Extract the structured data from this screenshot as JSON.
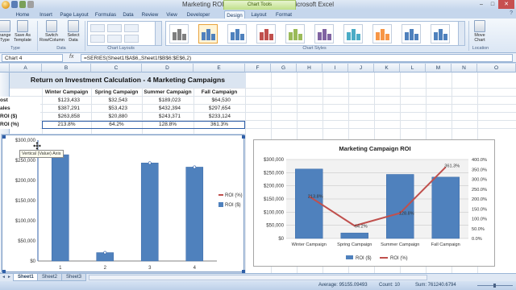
{
  "window": {
    "title": "Marketing ROI Calculation Example - Microsoft Excel",
    "context_tab": "Chart Tools"
  },
  "ribbon_tabs": [
    "Home",
    "Insert",
    "Page Layout",
    "Formulas",
    "Data",
    "Review",
    "View",
    "Developer",
    "Design",
    "Layout",
    "Format"
  ],
  "active_tab": "Design",
  "ribbon": {
    "change_type": "hange\nType",
    "save_template": "Save As\nTemplate",
    "switch": "Switch\nRow/Column",
    "select_data": "Select\nData",
    "move_chart": "Move\nChart",
    "groups": {
      "type": "Type",
      "data": "Data",
      "layouts": "Chart Layouts",
      "styles": "Chart Styles",
      "location": "Location"
    },
    "style_colors": [
      "#7f7f7f",
      "#4f81bd",
      "#4f81bd",
      "#c0504d",
      "#9bbb59",
      "#8064a2",
      "#4bacc6",
      "#f79646",
      "#4f81bd",
      "#4f81bd"
    ]
  },
  "formula_bar": {
    "name_box": "Chart 4",
    "fx": "fx",
    "formula": "=SERIES(Sheet1!$A$6,,Sheet1!$B$6:$E$6,2)"
  },
  "columns": [
    "A",
    "B",
    "C",
    "D",
    "E",
    "F",
    "G",
    "H",
    "I",
    "J",
    "K",
    "L",
    "M",
    "N",
    "O"
  ],
  "table": {
    "title": "Return on Investment Calculation - 4 Marketing Campaigns",
    "headers": [
      "Winter Campaign",
      "Spring Campaign",
      "Summer Campaign",
      "Fall Campaign"
    ],
    "rows": [
      {
        "label": "ost",
        "values": [
          "$123,433",
          "$32,543",
          "$189,023",
          "$64,530"
        ]
      },
      {
        "label": "ales",
        "values": [
          "$387,291",
          "$53,423",
          "$432,394",
          "$297,654"
        ]
      },
      {
        "label": "ROI ($)",
        "values": [
          "$263,858",
          "$20,880",
          "$243,371",
          "$233,124"
        ]
      },
      {
        "label": "ROI (%)",
        "values": [
          "213.8%",
          "64.2%",
          "128.8%",
          "361.3%"
        ]
      }
    ]
  },
  "chart1": {
    "tooltip": "Vertical (Value) Axis",
    "y_ticks": [
      "$300,000",
      "$250,000",
      "$200,000",
      "$150,000",
      "$100,000",
      "$50,000",
      "$0"
    ],
    "x_ticks": [
      "1",
      "2",
      "3",
      "4"
    ],
    "legend": [
      "ROI (%)",
      "ROI ($)"
    ]
  },
  "chart2": {
    "title": "Marketing Campaign ROI",
    "y_left": [
      "$300,000",
      "$250,000",
      "$200,000",
      "$150,000",
      "$100,000",
      "$50,000",
      "$0"
    ],
    "y_right": [
      "400.0%",
      "350.0%",
      "300.0%",
      "250.0%",
      "200.0%",
      "150.0%",
      "100.0%",
      "50.0%",
      "0.0%"
    ],
    "categories": [
      "Winter Campaign",
      "Spring Campaign",
      "Summer Campaign",
      "Fall Campaign"
    ],
    "data_labels": [
      "213.8%",
      "64.2%",
      "128.8%",
      "361.3%"
    ],
    "legend": [
      "ROI ($)",
      "ROI (%)"
    ]
  },
  "chart_data": [
    {
      "type": "bar",
      "categories": [
        "1",
        "2",
        "3",
        "4"
      ],
      "series": [
        {
          "name": "ROI ($)",
          "values": [
            263858,
            20880,
            243371,
            233124
          ]
        }
      ],
      "ylim": [
        0,
        300000
      ],
      "legend_entries": [
        "ROI (%)",
        "ROI ($)"
      ],
      "legend": "right",
      "grid": false,
      "colors": {
        "bar": "#4f81bd"
      }
    },
    {
      "type": "bar",
      "title": "Marketing Campaign ROI",
      "categories": [
        "Winter Campaign",
        "Spring Campaign",
        "Summer Campaign",
        "Fall Campaign"
      ],
      "series": [
        {
          "name": "ROI ($)",
          "type": "bar",
          "axis": "left",
          "values": [
            263858,
            20880,
            243371,
            233124
          ]
        },
        {
          "name": "ROI (%)",
          "type": "line",
          "axis": "right",
          "values": [
            213.8,
            64.2,
            128.8,
            361.3
          ]
        }
      ],
      "ylim": [
        0,
        300000
      ],
      "y2lim": [
        0,
        400
      ],
      "legend": "bottom",
      "grid": true,
      "colors": {
        "bar": "#4f81bd",
        "line": "#c0504d"
      }
    }
  ],
  "sheets": [
    "Sheet1",
    "Sheet2",
    "Sheet3"
  ],
  "active_sheet": "Sheet1",
  "status": {
    "average": "Average: 95155.09493",
    "count": "Count: 10",
    "sum": "Sum: 761240.6794"
  }
}
